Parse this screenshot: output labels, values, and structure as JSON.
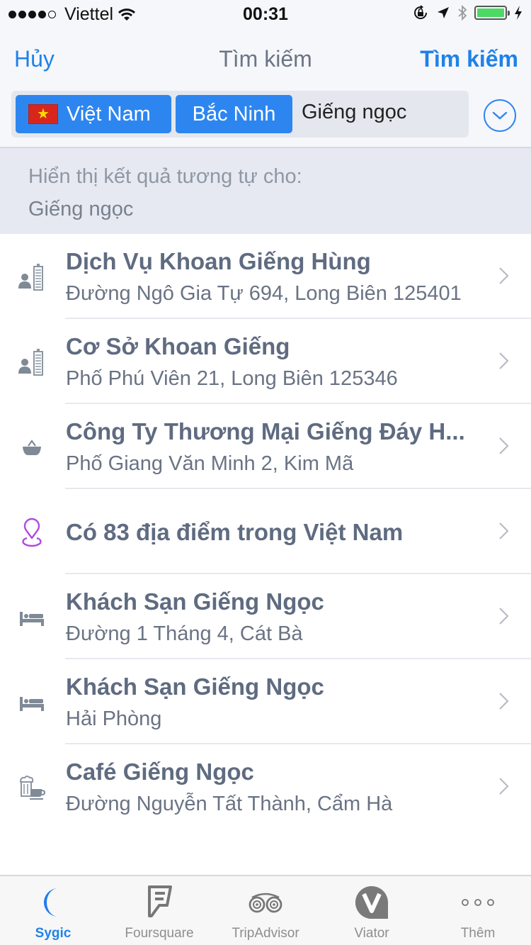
{
  "status_bar": {
    "signal_bars_filled": 4,
    "signal_bars_total": 5,
    "carrier": "Viettel",
    "time": "00:31",
    "battery_percent": 100,
    "charging": true,
    "icons": [
      "wifi-icon",
      "rotation-lock-icon",
      "location-arrow-icon",
      "bluetooth-icon",
      "battery-icon",
      "charging-bolt-icon"
    ]
  },
  "nav": {
    "cancel_label": "Hủy",
    "title": "Tìm kiếm",
    "search_label": "Tìm kiếm"
  },
  "search": {
    "country_chip": "Việt Nam",
    "country_flag_icon": "vietnam-flag-icon",
    "region_chip": "Bắc Ninh",
    "query": "Giếng ngọc",
    "expand_icon": "chevron-down-circle-icon"
  },
  "hint": {
    "line1": "Hiển thị kết quả tương tự cho:",
    "line2": "Giếng ngọc"
  },
  "results": [
    {
      "title": "Dịch Vụ Khoan Giếng Hùng",
      "subtitle": "Đường Ngô Gia Tự 694, Long Biên 125401",
      "icon": "business-icon"
    },
    {
      "title": "Cơ Sở Khoan Giếng",
      "subtitle": "Phố Phú Viên 21, Long Biên 125346",
      "icon": "business-icon"
    },
    {
      "title": "Công Ty Thương Mại Giếng Đáy H...",
      "subtitle": "Phố Giang Văn Minh 2, Kim Mã",
      "icon": "shopping-basket-icon"
    },
    {
      "title": "Có 83 địa điểm trong Việt Nam",
      "subtitle": "",
      "icon": "map-pin-icon"
    },
    {
      "title": "Khách Sạn Giếng Ngọc",
      "subtitle": "Đường 1 Tháng 4, Cát Bà",
      "icon": "bed-icon"
    },
    {
      "title": "Khách Sạn Giếng Ngọc",
      "subtitle": "Hải Phòng",
      "icon": "bed-icon"
    },
    {
      "title": "Café Giếng Ngọc",
      "subtitle": "Đường Nguyễn Tất Thành, Cẩm Hà",
      "icon": "cafe-icon"
    }
  ],
  "tabbar": {
    "tabs": [
      {
        "label": "Sygic",
        "icon": "sygic-moon-icon",
        "active": true
      },
      {
        "label": "Foursquare",
        "icon": "foursquare-icon",
        "active": false
      },
      {
        "label": "TripAdvisor",
        "icon": "tripadvisor-owl-icon",
        "active": false
      },
      {
        "label": "Viator",
        "icon": "viator-icon",
        "active": false
      },
      {
        "label": "Thêm",
        "icon": "more-dots-icon",
        "active": false
      }
    ]
  },
  "colors": {
    "accent": "#1f82e8",
    "chip": "#2d86f0",
    "pin": "#b04be0",
    "battery": "#4cd964"
  }
}
